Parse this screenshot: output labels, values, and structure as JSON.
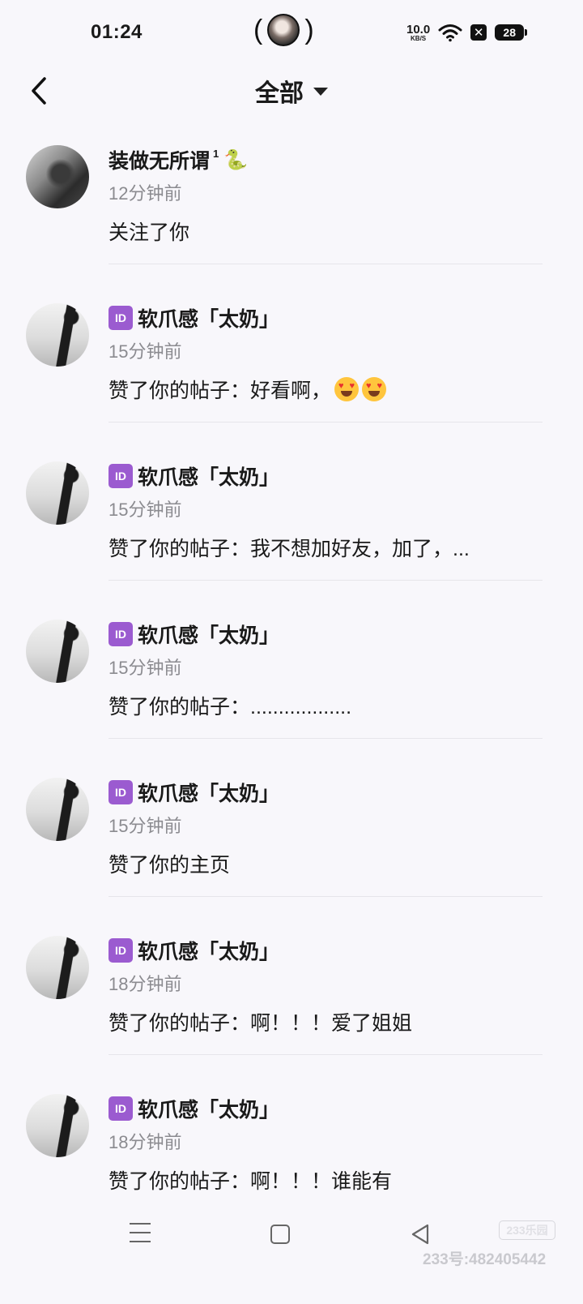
{
  "status_bar": {
    "time": "01:24",
    "net_speed": "10.0",
    "net_unit": "KB/S",
    "battery": "28"
  },
  "header": {
    "title": "全部"
  },
  "notifications": [
    {
      "username": "装做无所谓",
      "sup": "1",
      "time": "12分钟前",
      "content": "关注了你",
      "has_id_badge": false
    },
    {
      "username": "软爪感「太奶」",
      "time": "15分钟前",
      "content": "赞了你的帖子：好看啊，",
      "emoji_count": 2,
      "has_id_badge": true
    },
    {
      "username": "软爪感「太奶」",
      "time": "15分钟前",
      "content": "赞了你的帖子：我不想加好友，加了，...",
      "has_id_badge": true
    },
    {
      "username": "软爪感「太奶」",
      "time": "15分钟前",
      "content": "赞了你的帖子：..................",
      "has_id_badge": true
    },
    {
      "username": "软爪感「太奶」",
      "time": "15分钟前",
      "content": "赞了你的主页",
      "has_id_badge": true
    },
    {
      "username": "软爪感「太奶」",
      "time": "18分钟前",
      "content": "赞了你的帖子：啊！！！爱了姐姐",
      "has_id_badge": true
    },
    {
      "username": "软爪感「太奶」",
      "time": "18分钟前",
      "content": "赞了你的帖子：啊！！！谁能有",
      "has_id_badge": true
    }
  ],
  "id_badge_text": "ID",
  "watermark": {
    "badge": "233乐园",
    "text": "233号:482405442"
  }
}
